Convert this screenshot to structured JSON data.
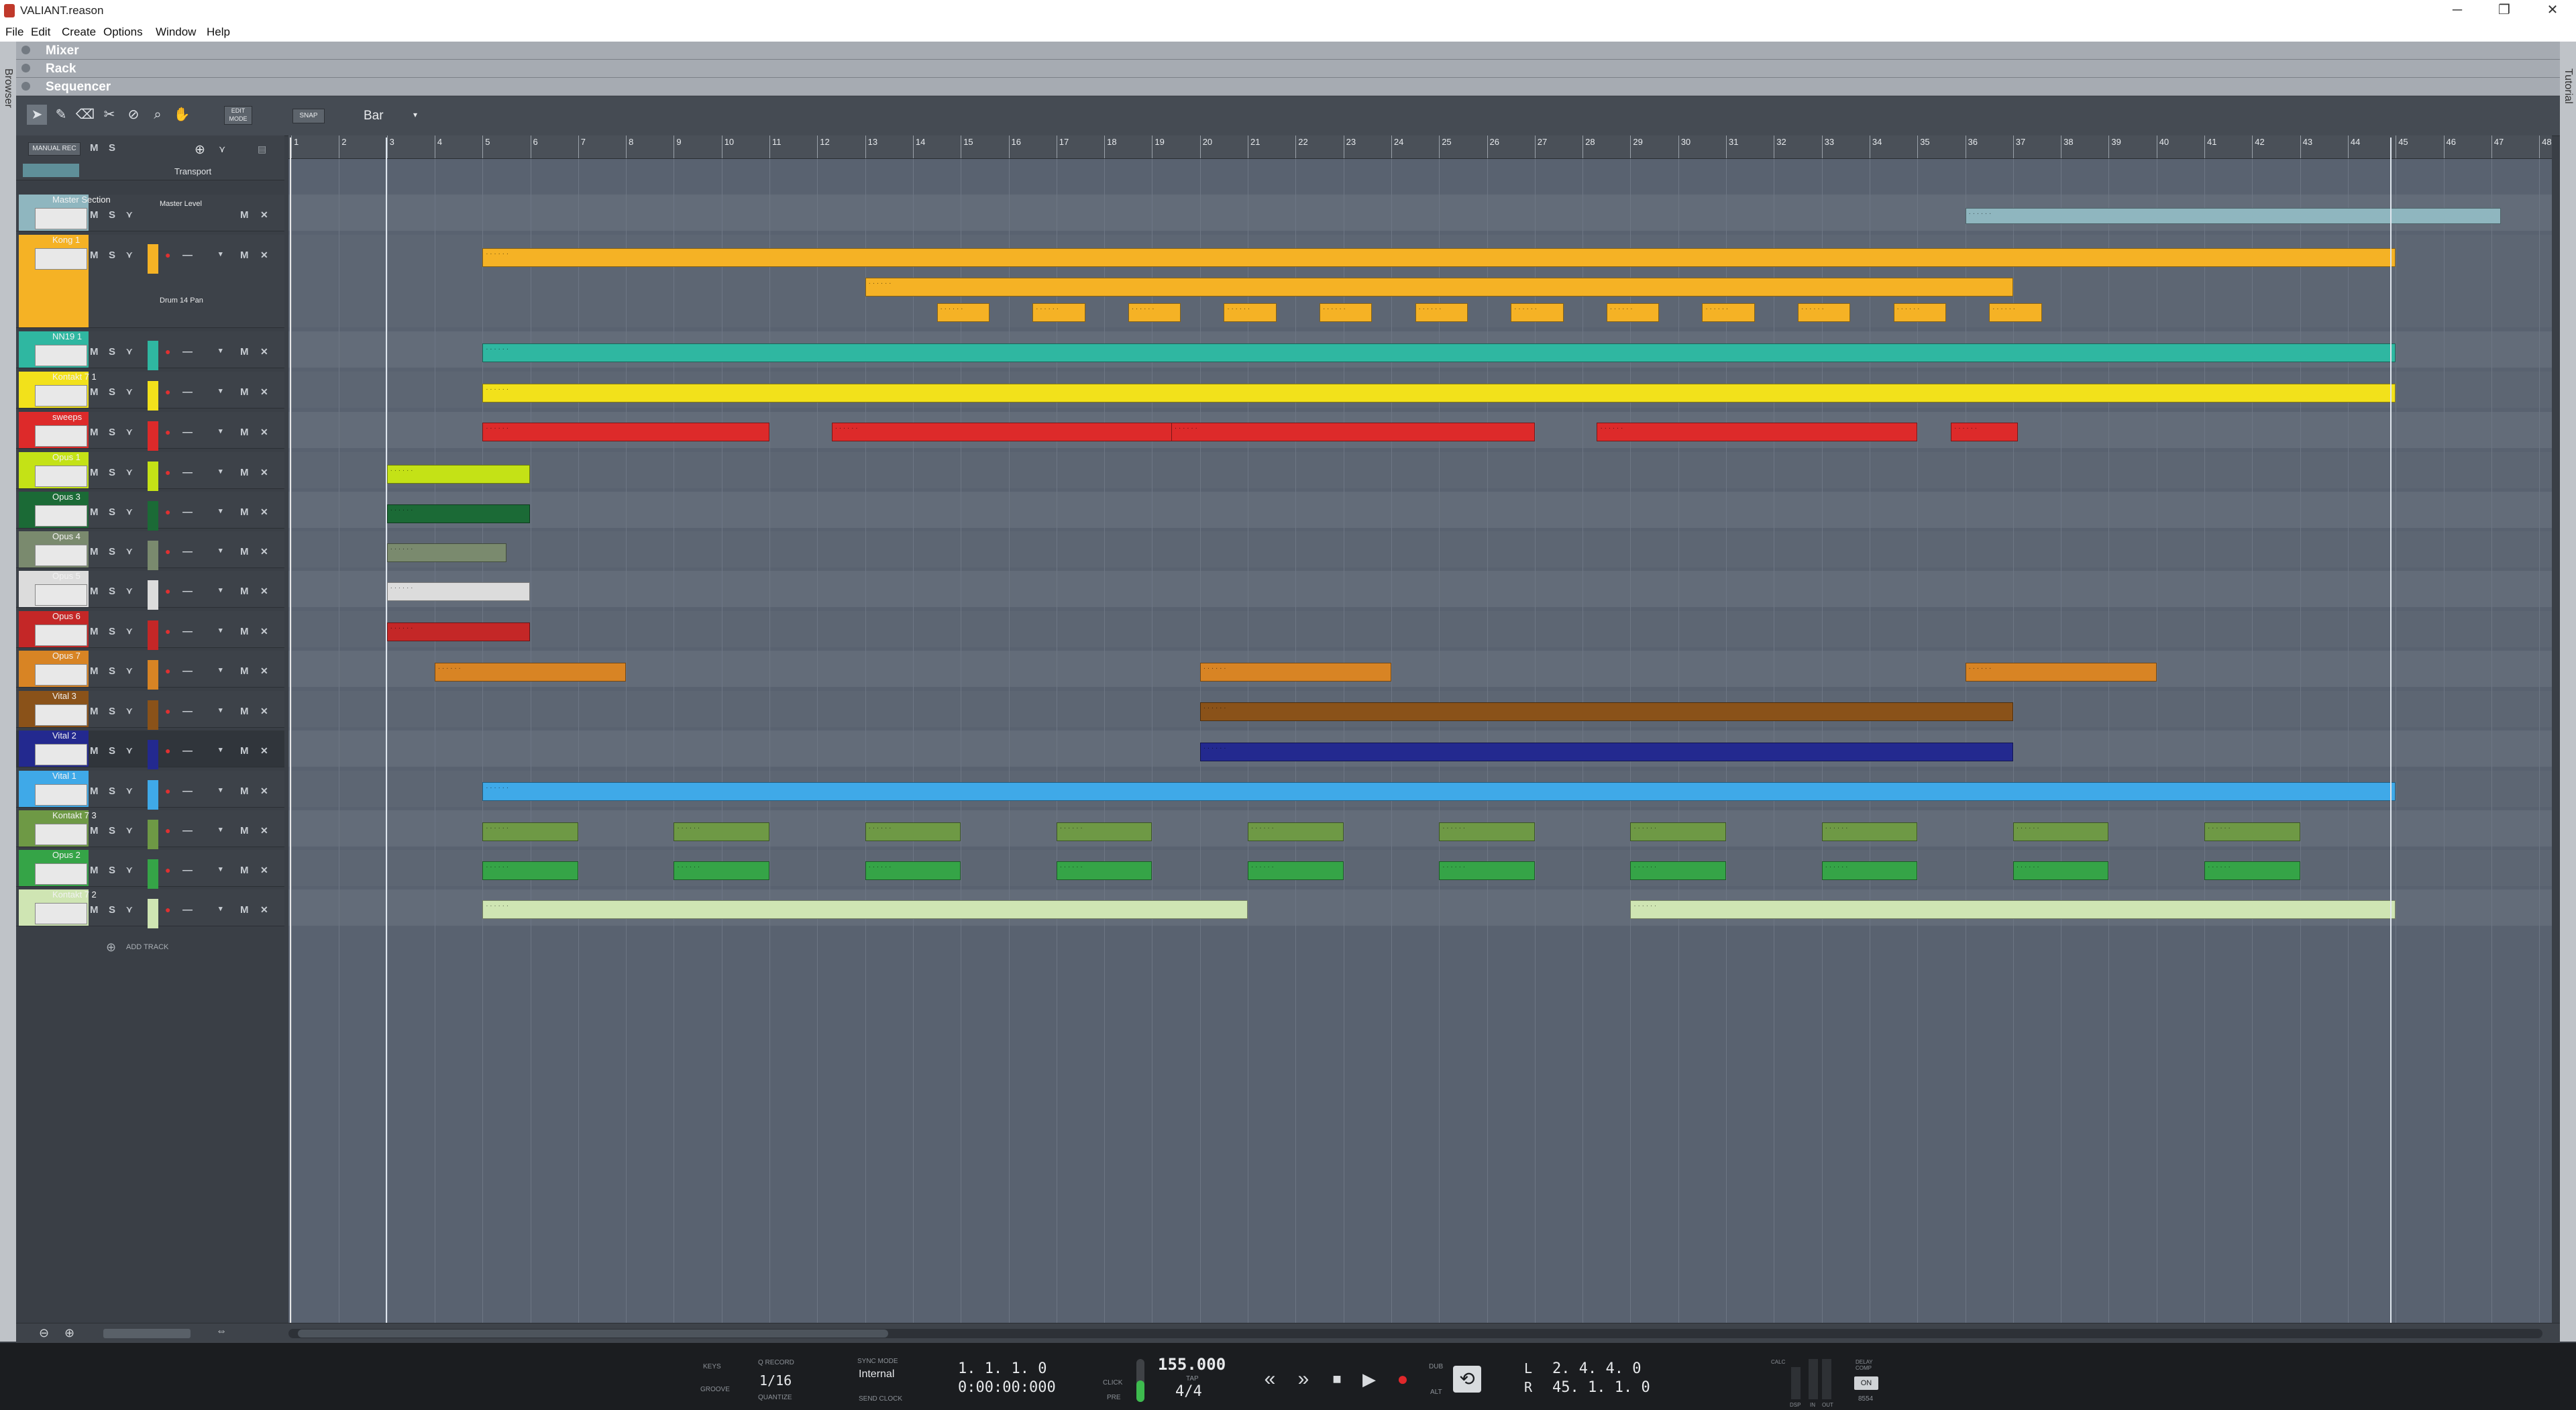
{
  "window": {
    "title": "VALIANT.reason",
    "controls": [
      "─",
      "❐",
      "✕"
    ]
  },
  "menu": [
    "File",
    "Edit",
    "Create",
    "Options",
    "Window",
    "Help"
  ],
  "side_strips": {
    "left": "Browser",
    "right": "Tutorial"
  },
  "sections": [
    "Mixer",
    "Rack",
    "Sequencer"
  ],
  "toolbar": {
    "edit_mode": "EDIT MODE",
    "snap": "SNAP",
    "snap_value": "Bar"
  },
  "tracklist_header": {
    "manual_rec": "MANUAL REC",
    "mute": "M",
    "solo": "S",
    "transport": "Transport"
  },
  "ruler": {
    "bars": [
      "1",
      "2",
      "3",
      "4",
      "5",
      "6",
      "7",
      "8",
      "9",
      "10",
      "11",
      "12",
      "13",
      "14",
      "15",
      "16",
      "17",
      "18",
      "19",
      "20",
      "21",
      "22",
      "23",
      "24",
      "25",
      "26",
      "27",
      "28",
      "29",
      "30",
      "31",
      "32",
      "33",
      "34",
      "35",
      "36",
      "37",
      "38",
      "39",
      "40",
      "41",
      "42",
      "43",
      "44",
      "45",
      "46",
      "47",
      "48"
    ]
  },
  "tracks": [
    {
      "name": "Master Section",
      "color": "#8fb6bf",
      "sub": "Master Level"
    },
    {
      "name": "Kong 1",
      "color": "#f5b225",
      "sub": "Drum 14 Pan"
    },
    {
      "name": "NN19 1",
      "color": "#2fb7a1"
    },
    {
      "name": "Kontakt 7 1",
      "color": "#f2e11b"
    },
    {
      "name": "sweeps",
      "color": "#dd2a2a"
    },
    {
      "name": "Opus 1",
      "color": "#c4e216"
    },
    {
      "name": "Opus 3",
      "color": "#1b6a36"
    },
    {
      "name": "Opus 4",
      "color": "#7a8a6e"
    },
    {
      "name": "Opus 5",
      "color": "#dcdcdc"
    },
    {
      "name": "Opus 6",
      "color": "#c42727"
    },
    {
      "name": "Opus 7",
      "color": "#d88424"
    },
    {
      "name": "Vital 3",
      "color": "#8a5219"
    },
    {
      "name": "Vital 2",
      "color": "#23298f"
    },
    {
      "name": "Vital 1",
      "color": "#3fa9e8"
    },
    {
      "name": "Kontakt 7 3",
      "color": "#6e9945"
    },
    {
      "name": "Opus 2",
      "color": "#35a447"
    },
    {
      "name": "Kontakt 7 2",
      "color": "#cfe5b3"
    }
  ],
  "add_track": "ADD TRACK",
  "transport": {
    "keys": "KEYS",
    "groove": "GROOVE",
    "q_record": "Q RECORD",
    "quantize_value": "1/16",
    "quantize": "QUANTIZE",
    "sync_mode": "SYNC MODE",
    "sync_value": "Internal",
    "send_clock": "SEND CLOCK",
    "position_bars": "1.  1.  1.    0",
    "position_time": "0:00:00:000",
    "click": "CLICK",
    "pre": "PRE",
    "tempo": "155.000",
    "tap": "TAP",
    "signature": "4/4",
    "dub": "DUB",
    "alt": "ALT",
    "loop_left_label": "L",
    "loop_right_label": "R",
    "loop_left": "2.  4.  4.    0",
    "loop_right": "45.  1.  1.    0",
    "calc": "CALC",
    "dsp": "DSP",
    "in": "IN",
    "out": "OUT",
    "delay_comp": "DELAY COMP",
    "delay_on": "ON",
    "delay_value": "8554"
  }
}
